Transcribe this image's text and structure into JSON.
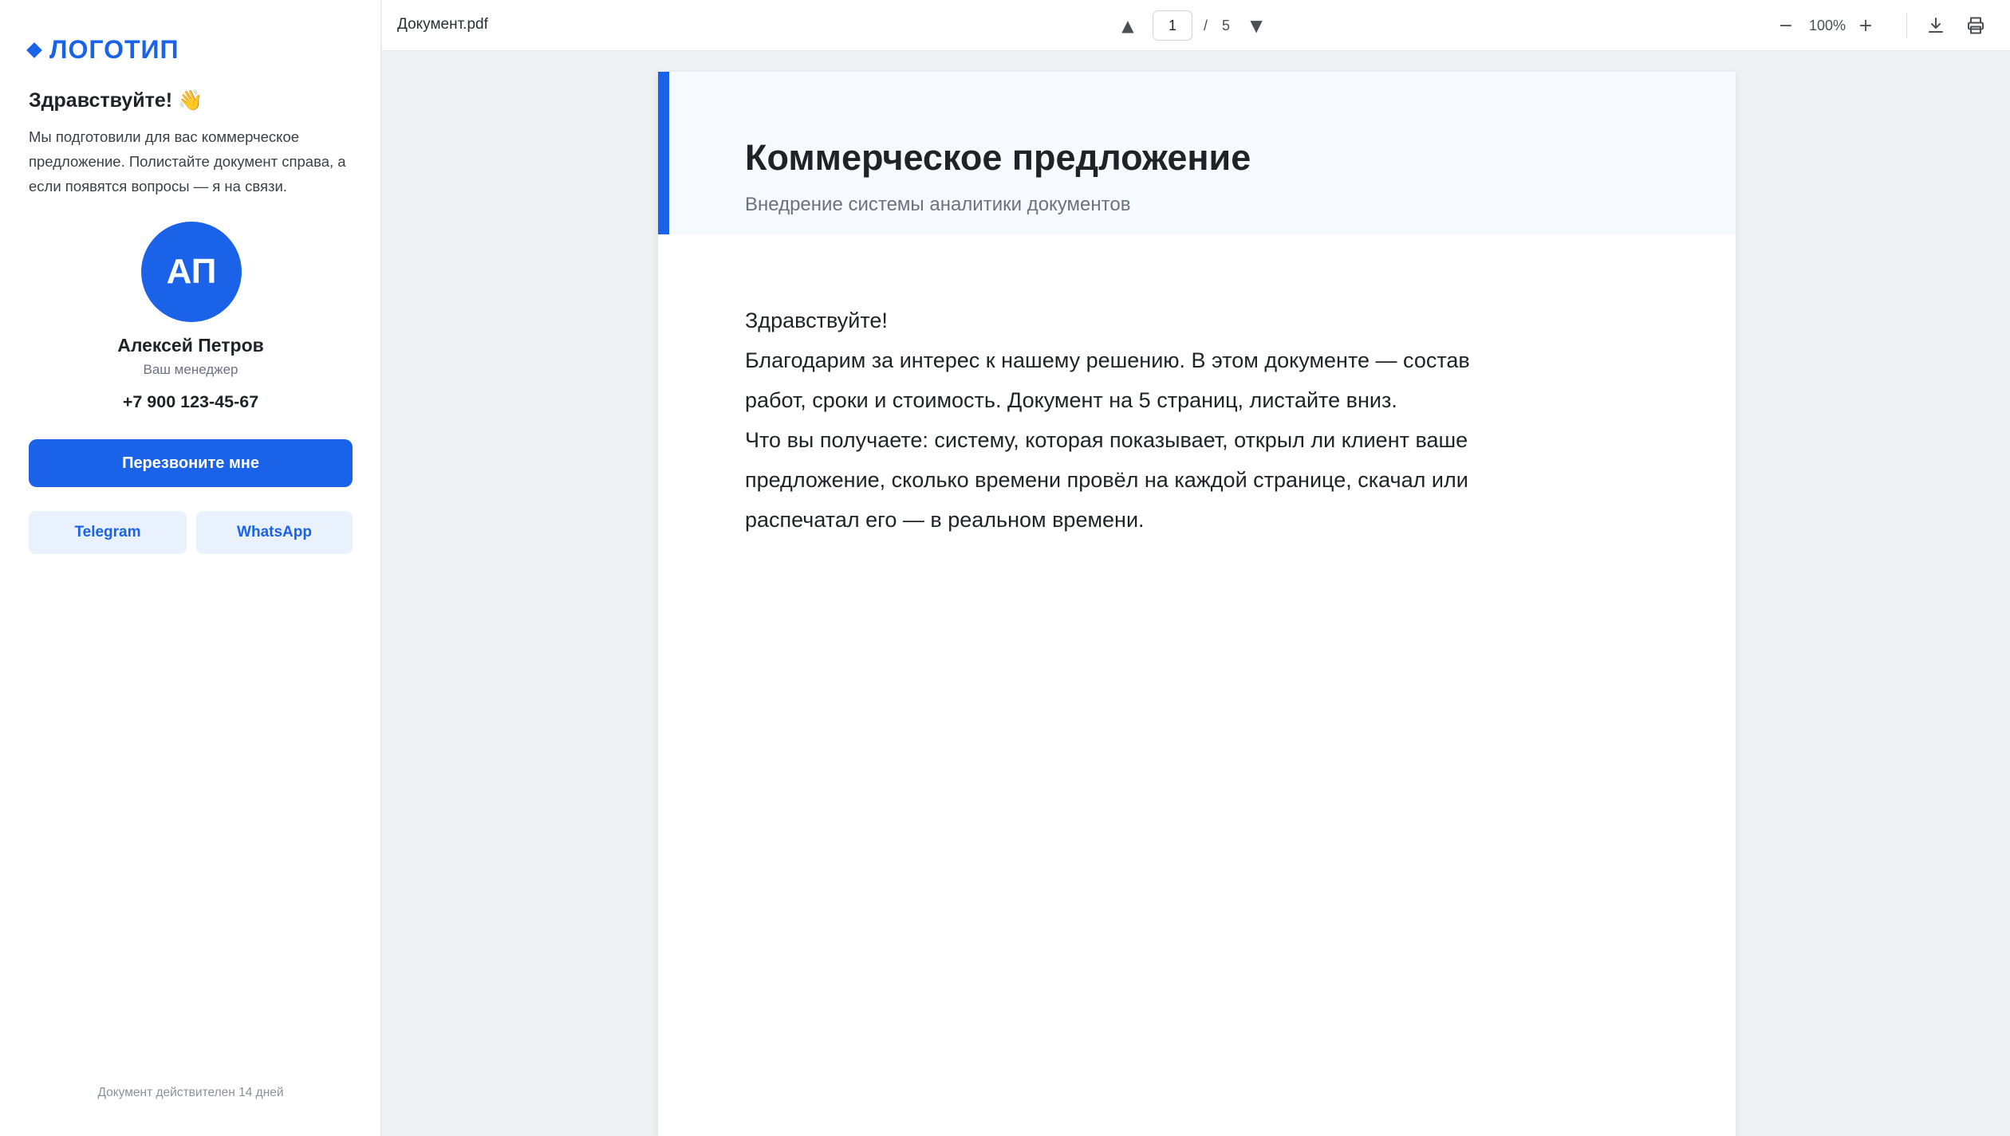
{
  "sidebar": {
    "logo": "ЛОГОТИП",
    "greeting_title": "Здравствуйте! 👋",
    "greeting_text": "Мы подготовили для вас коммерческое предложение. Полистайте документ справа, а если появятся вопросы — я на связи.",
    "avatar_initials": "АП",
    "manager_name": "Алексей Петров",
    "manager_role": "Ваш менеджер",
    "manager_phone": "+7 900 123-45-67",
    "callback_label": "Перезвоните мне",
    "telegram_label": "Telegram",
    "whatsapp_label": "WhatsApp",
    "validity": "Документ действителен 14 дней"
  },
  "toolbar": {
    "filename": "Документ.pdf",
    "current_page": "1",
    "page_separator": "/",
    "total_pages": "5",
    "zoom_level": "100%",
    "prev_icon": "▲",
    "next_icon": "▼",
    "zoom_out_icon": "−",
    "zoom_in_icon": "+"
  },
  "document": {
    "title": "Коммерческое предложение",
    "subtitle": "Внедрение системы аналитики документов",
    "greeting": "Здравствуйте!",
    "para1": "Благодарим за интерес к нашему решению. В этом документе — состав работ, сроки и стоимость. Документ на 5 страниц, листайте вниз.",
    "para2": "Что вы получаете: систему, которая показывает, открыл ли клиент ваше предложение, сколько времени провёл на каждой странице, скачал или распечатал его — в реальном времени."
  },
  "colors": {
    "accent": "#1a63e8",
    "accent_soft": "#e9f1fd",
    "header_bg": "#f6f9fd"
  },
  "icons": {
    "logo": "diamond-icon",
    "download": "download-icon",
    "print": "printer-icon",
    "prev": "triangle-up-icon",
    "next": "triangle-down-icon"
  }
}
